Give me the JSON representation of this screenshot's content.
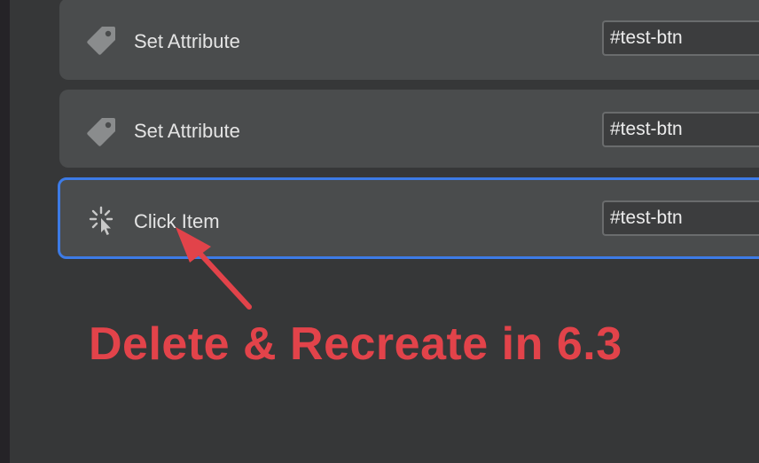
{
  "actions": [
    {
      "icon": "tag-icon",
      "label": "Set Attribute",
      "selector": "#test-btn",
      "selected": false
    },
    {
      "icon": "tag-icon",
      "label": "Set Attribute",
      "selector": "#test-btn",
      "selected": false
    },
    {
      "icon": "click-icon",
      "label": "Click Item",
      "selector": "#test-btn",
      "selected": true
    }
  ],
  "annotation": {
    "text": "Delete & Recreate in 6.3",
    "color": "#e2434a"
  },
  "colors": {
    "selection_border": "#3d7be6",
    "row_background": "#4a4c4d",
    "panel_background": "#363738"
  }
}
